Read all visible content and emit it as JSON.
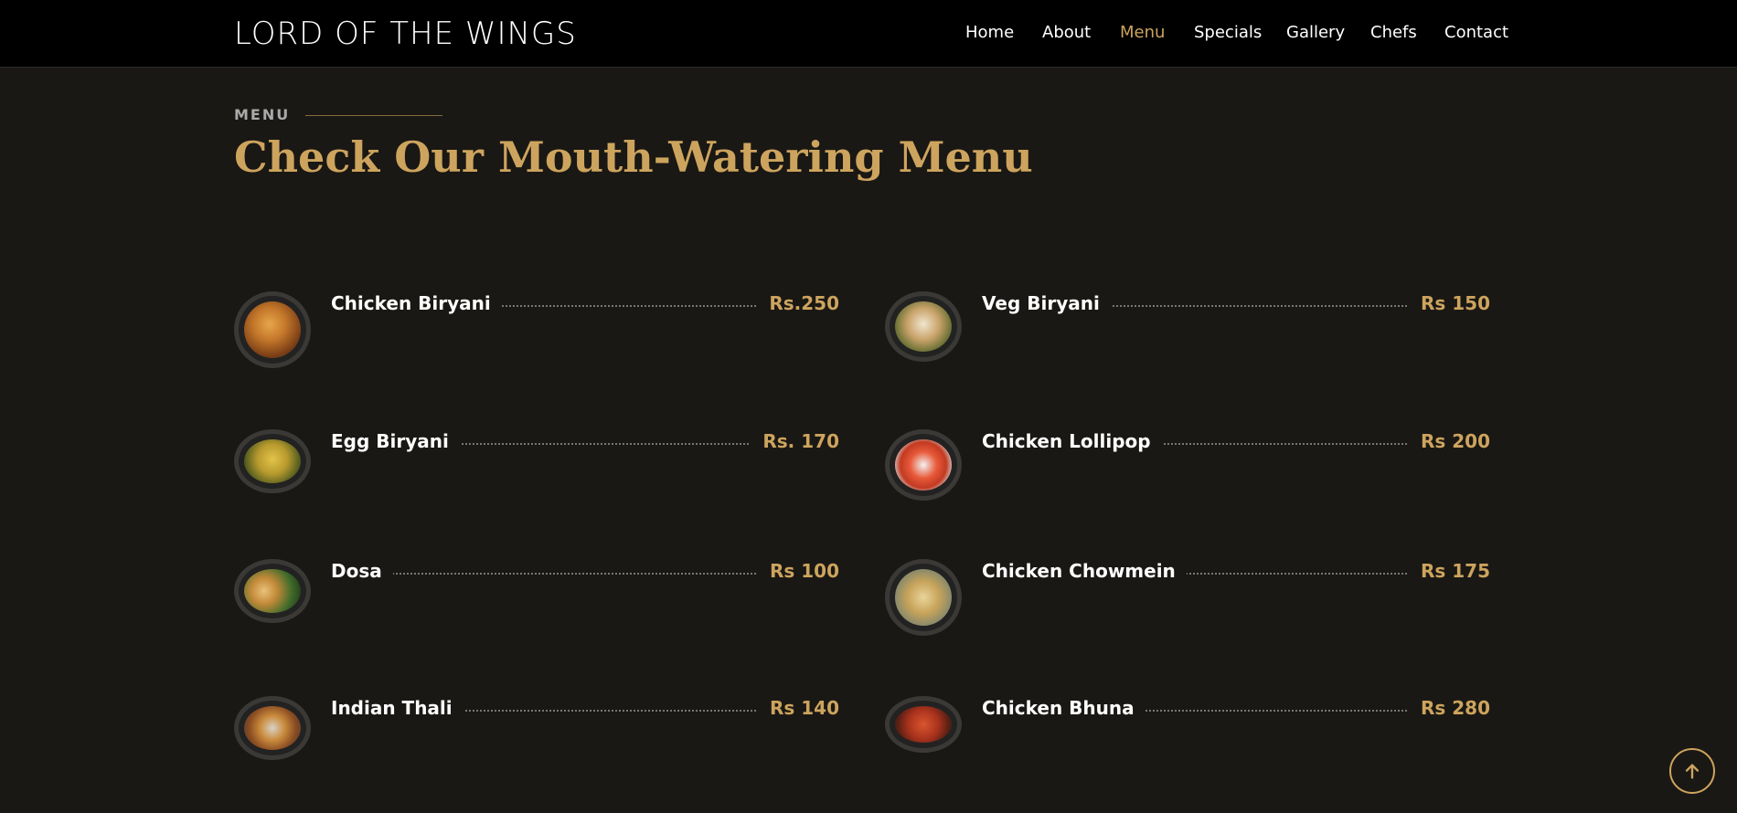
{
  "header": {
    "brand": "LORD OF THE WINGS",
    "nav": [
      {
        "label": "Home",
        "active": false
      },
      {
        "label": "About",
        "active": false
      },
      {
        "label": "Menu",
        "active": true
      },
      {
        "label": "Specials",
        "active": false
      },
      {
        "label": "Gallery",
        "active": false
      },
      {
        "label": "Chefs",
        "active": false
      },
      {
        "label": "Contact",
        "active": false
      }
    ]
  },
  "section": {
    "eyebrow": "MENU",
    "title": "Check Our Mouth-Watering Menu"
  },
  "menu_items": [
    {
      "name": "Chicken Biryani",
      "price": "Rs.250"
    },
    {
      "name": "Veg Biryani",
      "price": "Rs 150"
    },
    {
      "name": "Egg Biryani",
      "price": "Rs. 170"
    },
    {
      "name": "Chicken Lollipop",
      "price": "Rs 200"
    },
    {
      "name": "Dosa",
      "price": "Rs 100"
    },
    {
      "name": "Chicken Chowmein",
      "price": "Rs 175"
    },
    {
      "name": "Indian Thali",
      "price": "Rs 140"
    },
    {
      "name": "Chicken Bhuna",
      "price": "Rs 280"
    }
  ],
  "colors": {
    "accent": "#cda45e",
    "background": "#1a1814",
    "header_bg": "#000000"
  },
  "icons": {
    "back_to_top": "arrow-up-icon"
  }
}
